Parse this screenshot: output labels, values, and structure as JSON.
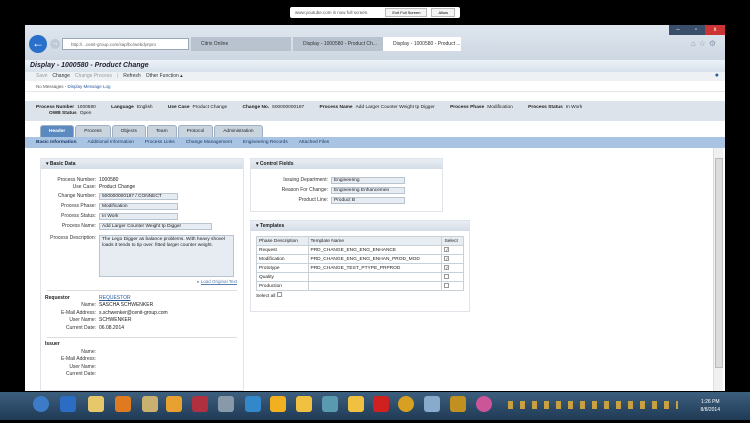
{
  "fullscreen_notice": {
    "text": "www.youtube.com is now full screen.",
    "exit": "Exit Full Screen",
    "allow": "Allow"
  },
  "browser": {
    "address": "http://...cenit-group.com/sap/bc/webdynpro",
    "tabs": [
      "Citrix Online",
      "Display - 1000580 - Product Ch...",
      "Display - 1000580 - Product ..."
    ]
  },
  "page_title": "Display - 1000580 - Product Change",
  "toolbar": {
    "save": "Save",
    "change": "Change",
    "change_process": "Change Process",
    "refresh": "Refresh",
    "other": "Other Function"
  },
  "messages": {
    "none": "No Messages",
    "log": "Display Message Log"
  },
  "header": [
    {
      "k": "Process Number",
      "v": "1000580"
    },
    {
      "k": "Language",
      "v": "English"
    },
    {
      "k": "Use Case",
      "v": "Product Change"
    },
    {
      "k": "Change No.",
      "v": "500000000187"
    },
    {
      "k": "Process Name",
      "v": "Add Larger Counter Weight tp Digger"
    },
    {
      "k": "Process Phase",
      "v": "Modification"
    },
    {
      "k": "Process Status",
      "v": "In Work"
    },
    {
      "k": "OWB Status",
      "v": "Open"
    }
  ],
  "tabs": [
    "Header",
    "Process",
    "Objects",
    "Team",
    "Protocol",
    "Administration"
  ],
  "subtabs": [
    "Basic Information",
    "Additional Information",
    "Process Links",
    "Change Management",
    "Engineering Records",
    "Attached Files"
  ],
  "basic": {
    "title": "Basic Data",
    "process_number_l": "Process Number:",
    "process_number": "1000580",
    "use_case_l": "Use Case:",
    "use_case": "Product Change",
    "change_number_l": "Change Number:",
    "change_number": "500000000187 / CONNECT",
    "phase_l": "Process Phase:",
    "phase": "Modification",
    "status_l": "Process Status:",
    "status": "In Work",
    "name_l": "Process Name:",
    "name": "Add Larger Counter Weight tp Digger",
    "desc_l": "Process Description:",
    "desc": "The Lego Digger as balance problems. With heavy shovel loads it tends to tip over. fitted larger counter weight.",
    "load": "Load Original Text"
  },
  "requestor": {
    "title": "Requestor",
    "link": "REQUESTOR",
    "name_l": "Name:",
    "name": "SASCHA SCHWENKER",
    "email_l": "E-Mail Address:",
    "email": "s.schwenker@cenit-group.com",
    "user_l": "User Name:",
    "user": "SCHWENKER",
    "date_l": "Current Date:",
    "date": "06.08.2014"
  },
  "issuer": {
    "title": "Issuer",
    "name_l": "Name:",
    "email_l": "E-Mail Address:",
    "user_l": "User Name:",
    "date_l": "Current Date:"
  },
  "control": {
    "title": "Control Fields",
    "dept_l": "Issuing Department:",
    "dept": "Engineering",
    "reason_l": "Reason For Change:",
    "reason": "Engineering Enhancemen",
    "line_l": "Product Line:",
    "line": "Product B"
  },
  "templates": {
    "title": "Templates",
    "cols": [
      "Phase Description",
      "Template Name",
      "Select"
    ],
    "rows": [
      {
        "phase": "Request",
        "name": "PRD_CHANGE_ENG_ENG_ENHANCE",
        "checked": true
      },
      {
        "phase": "Modification",
        "name": "PRD_CHANGE_ENG_ENG_ENHAN_PROD_MOD",
        "checked": true
      },
      {
        "phase": "Prototype",
        "name": "PRD_CHANGE_TEST_PTYPE_PRPROD",
        "checked": true
      },
      {
        "phase": "Quality",
        "name": "",
        "checked": false
      },
      {
        "phase": "Production",
        "name": "",
        "checked": false
      }
    ],
    "select_all": "Select all"
  },
  "taskbar": {
    "time": "1:26 PM",
    "date": "8/8/2014"
  }
}
